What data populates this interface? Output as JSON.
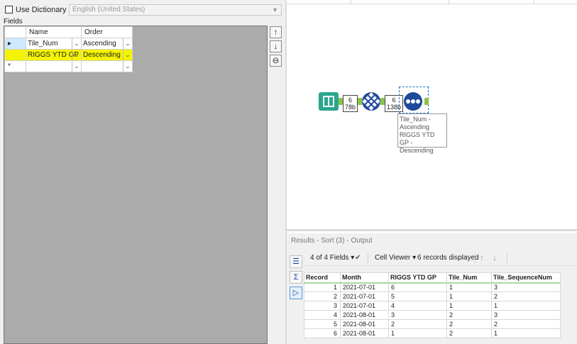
{
  "config": {
    "dictionary_order_label": "Use Dictionary Order",
    "dictionary_order_checked": false,
    "language_value": "English (United States)",
    "fields_label": "Fields",
    "columns": {
      "name": "Name",
      "order": "Order"
    },
    "rows": [
      {
        "marker": "▸",
        "name": "Tile_Num",
        "order": "Ascending"
      },
      {
        "marker": "",
        "name": "RIGGS YTD GP",
        "order": "Descending"
      },
      {
        "marker": "*",
        "name": "",
        "order": ""
      }
    ]
  },
  "canvas": {
    "input_badge": {
      "count": "6",
      "size": "78b"
    },
    "sort_badge": {
      "count": "6",
      "size": "138b"
    },
    "annotation": [
      "Tile_Num -",
      "Ascending",
      "RIGGS YTD GP -",
      "Descending"
    ],
    "icons": [
      "input-book-icon",
      "transform-grid-icon",
      "sort-dots-icon"
    ]
  },
  "results": {
    "title": "Results - Sort (3) - Output",
    "fields_summary": "4 of 4 Fields",
    "viewer": "Cell Viewer",
    "records_displayed": "6 records displayed",
    "columns": [
      "Record",
      "Month",
      "RIGGS YTD GP",
      "Tile_Num",
      "Tile_SequenceNum"
    ],
    "rows": [
      [
        "1",
        "2021-07-01",
        "6",
        "1",
        "3"
      ],
      [
        "2",
        "2021-07-01",
        "5",
        "1",
        "2"
      ],
      [
        "3",
        "2021-07-01",
        "4",
        "1",
        "1"
      ],
      [
        "4",
        "2021-08-01",
        "3",
        "2",
        "3"
      ],
      [
        "5",
        "2021-08-01",
        "2",
        "2",
        "2"
      ],
      [
        "6",
        "2021-08-01",
        "1",
        "2",
        "1"
      ]
    ]
  },
  "colors": {
    "highlight": "#f4f400",
    "tool_blue": "#1e4a9c",
    "input_green": "#2aa58e",
    "anchor_green": "#8bc34a"
  }
}
